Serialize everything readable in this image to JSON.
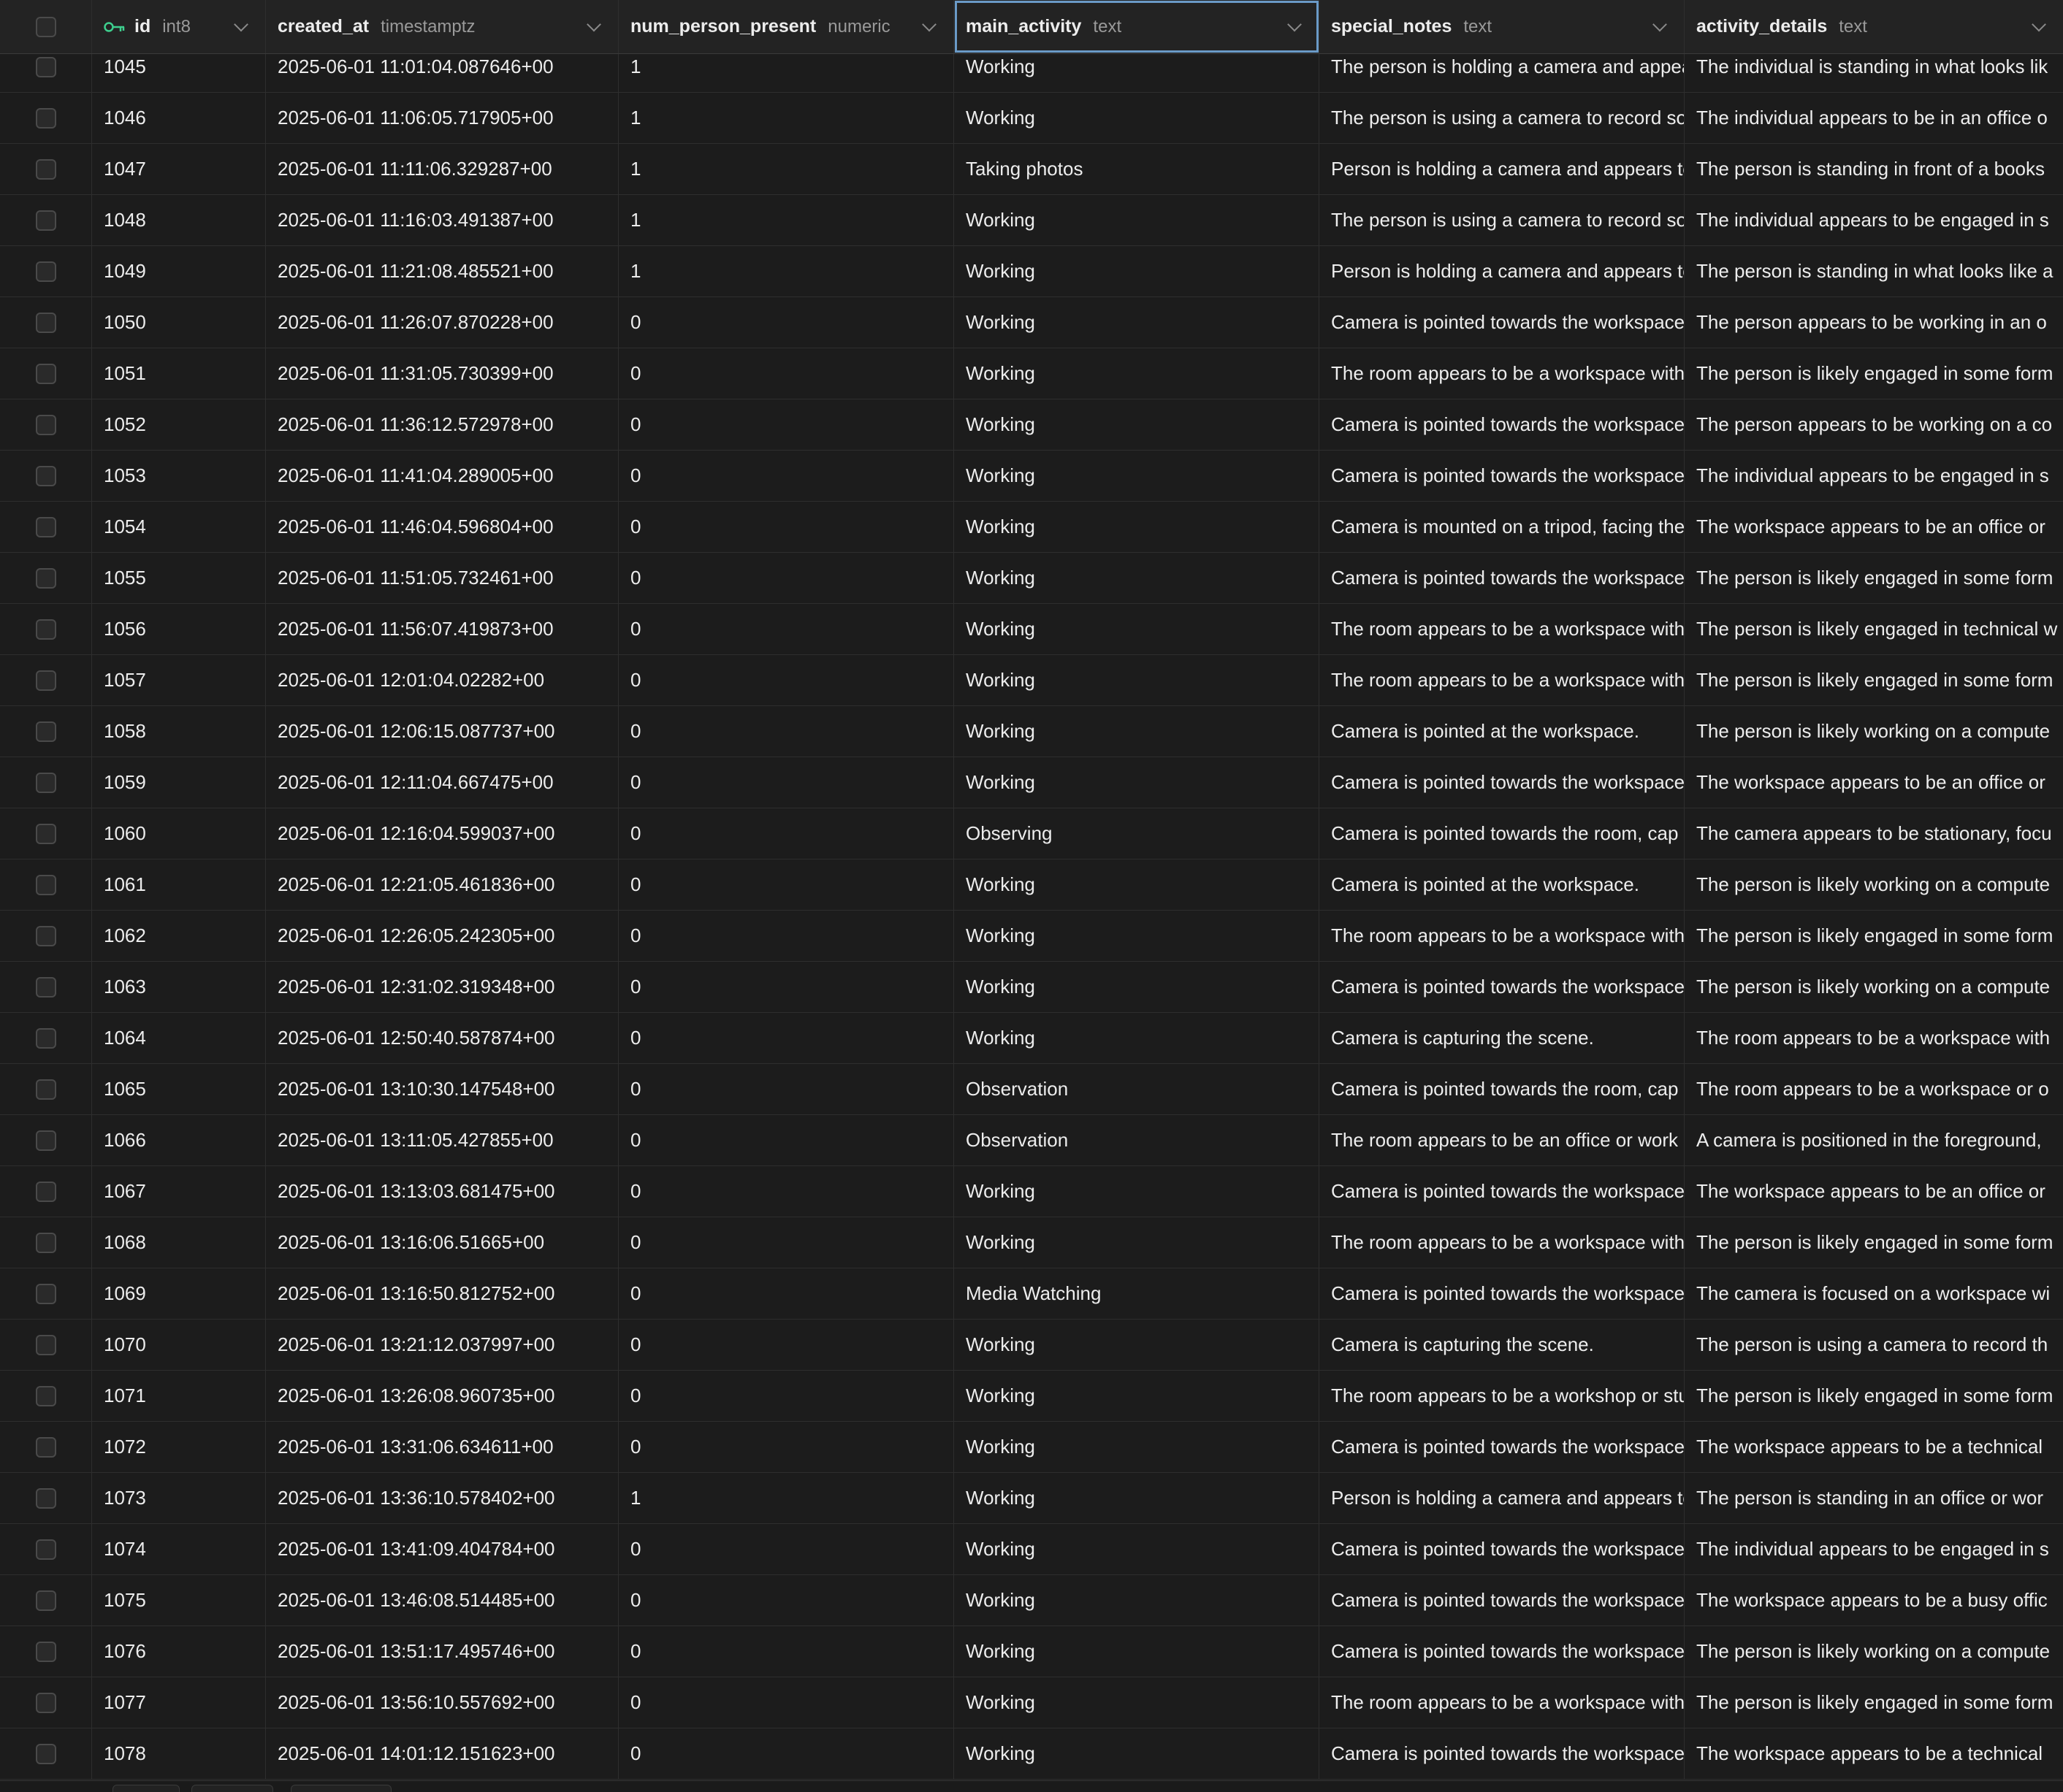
{
  "columns": [
    {
      "name": "id",
      "type": "int8",
      "primary_key": true
    },
    {
      "name": "created_at",
      "type": "timestamptz"
    },
    {
      "name": "num_person_present",
      "type": "numeric"
    },
    {
      "name": "main_activity",
      "type": "text",
      "selected": true
    },
    {
      "name": "special_notes",
      "type": "text"
    },
    {
      "name": "activity_details",
      "type": "text"
    }
  ],
  "rows": [
    [
      "1045",
      "2025-06-01 11:01:04.087646+00",
      "1",
      "Working",
      "The person is holding a camera and appea",
      "The individual is standing in what looks lik"
    ],
    [
      "1046",
      "2025-06-01 11:06:05.717905+00",
      "1",
      "Working",
      "The person is using a camera to record so",
      "The individual appears to be in an office o"
    ],
    [
      "1047",
      "2025-06-01 11:11:06.329287+00",
      "1",
      "Taking photos",
      "Person is holding a camera and appears to",
      "The person is standing in front of a books"
    ],
    [
      "1048",
      "2025-06-01 11:16:03.491387+00",
      "1",
      "Working",
      "The person is using a camera to record so",
      "The individual appears to be engaged in s"
    ],
    [
      "1049",
      "2025-06-01 11:21:08.485521+00",
      "1",
      "Working",
      "Person is holding a camera and appears to",
      "The person is standing in what looks like a"
    ],
    [
      "1050",
      "2025-06-01 11:26:07.870228+00",
      "0",
      "Working",
      "Camera is pointed towards the workspace",
      "The person appears to be working in an o"
    ],
    [
      "1051",
      "2025-06-01 11:31:05.730399+00",
      "0",
      "Working",
      "The room appears to be a workspace with",
      "The person is likely engaged in some form"
    ],
    [
      "1052",
      "2025-06-01 11:36:12.572978+00",
      "0",
      "Working",
      "Camera is pointed towards the workspace",
      "The person appears to be working on a co"
    ],
    [
      "1053",
      "2025-06-01 11:41:04.289005+00",
      "0",
      "Working",
      "Camera is pointed towards the workspace",
      "The individual appears to be engaged in s"
    ],
    [
      "1054",
      "2025-06-01 11:46:04.596804+00",
      "0",
      "Working",
      "Camera is mounted on a tripod, facing the",
      "The workspace appears to be an office or"
    ],
    [
      "1055",
      "2025-06-01 11:51:05.732461+00",
      "0",
      "Working",
      "Camera is pointed towards the workspace",
      "The person is likely engaged in some form"
    ],
    [
      "1056",
      "2025-06-01 11:56:07.419873+00",
      "0",
      "Working",
      "The room appears to be a workspace with",
      "The person is likely engaged in technical w"
    ],
    [
      "1057",
      "2025-06-01 12:01:04.02282+00",
      "0",
      "Working",
      "The room appears to be a workspace with",
      "The person is likely engaged in some form"
    ],
    [
      "1058",
      "2025-06-01 12:06:15.087737+00",
      "0",
      "Working",
      "Camera is pointed at the workspace.",
      "The person is likely working on a compute"
    ],
    [
      "1059",
      "2025-06-01 12:11:04.667475+00",
      "0",
      "Working",
      "Camera is pointed towards the workspace",
      "The workspace appears to be an office or"
    ],
    [
      "1060",
      "2025-06-01 12:16:04.599037+00",
      "0",
      "Observing",
      "Camera is pointed towards the room, cap",
      "The camera appears to be stationary, focu"
    ],
    [
      "1061",
      "2025-06-01 12:21:05.461836+00",
      "0",
      "Working",
      "Camera is pointed at the workspace.",
      "The person is likely working on a compute"
    ],
    [
      "1062",
      "2025-06-01 12:26:05.242305+00",
      "0",
      "Working",
      "The room appears to be a workspace with",
      "The person is likely engaged in some form"
    ],
    [
      "1063",
      "2025-06-01 12:31:02.319348+00",
      "0",
      "Working",
      "Camera is pointed towards the workspace",
      "The person is likely working on a compute"
    ],
    [
      "1064",
      "2025-06-01 12:50:40.587874+00",
      "0",
      "Working",
      "Camera is capturing the scene.",
      "The room appears to be a workspace with"
    ],
    [
      "1065",
      "2025-06-01 13:10:30.147548+00",
      "0",
      "Observation",
      "Camera is pointed towards the room, cap",
      "The room appears to be a workspace or o"
    ],
    [
      "1066",
      "2025-06-01 13:11:05.427855+00",
      "0",
      "Observation",
      "The room appears to be an office or work",
      "A camera is positioned in the foreground,"
    ],
    [
      "1067",
      "2025-06-01 13:13:03.681475+00",
      "0",
      "Working",
      "Camera is pointed towards the workspace",
      "The workspace appears to be an office or"
    ],
    [
      "1068",
      "2025-06-01 13:16:06.51665+00",
      "0",
      "Working",
      "The room appears to be a workspace with",
      "The person is likely engaged in some form"
    ],
    [
      "1069",
      "2025-06-01 13:16:50.812752+00",
      "0",
      "Media Watching",
      "Camera is pointed towards the workspace",
      "The camera is focused on a workspace wi"
    ],
    [
      "1070",
      "2025-06-01 13:21:12.037997+00",
      "0",
      "Working",
      "Camera is capturing the scene.",
      "The person is using a camera to record th"
    ],
    [
      "1071",
      "2025-06-01 13:26:08.960735+00",
      "0",
      "Working",
      "The room appears to be a workshop or stu",
      "The person is likely engaged in some form"
    ],
    [
      "1072",
      "2025-06-01 13:31:06.634611+00",
      "0",
      "Working",
      "Camera is pointed towards the workspace",
      "The workspace appears to be a technical"
    ],
    [
      "1073",
      "2025-06-01 13:36:10.578402+00",
      "1",
      "Working",
      "Person is holding a camera and appears to",
      "The person is standing in an office or wor"
    ],
    [
      "1074",
      "2025-06-01 13:41:09.404784+00",
      "0",
      "Working",
      "Camera is pointed towards the workspace",
      "The individual appears to be engaged in s"
    ],
    [
      "1075",
      "2025-06-01 13:46:08.514485+00",
      "0",
      "Working",
      "Camera is pointed towards the workspace",
      "The workspace appears to be a busy offic"
    ],
    [
      "1076",
      "2025-06-01 13:51:17.495746+00",
      "0",
      "Working",
      "Camera is pointed towards the workspace",
      "The person is likely working on a compute"
    ],
    [
      "1077",
      "2025-06-01 13:56:10.557692+00",
      "0",
      "Working",
      "The room appears to be a workspace with",
      "The person is likely engaged in some form"
    ],
    [
      "1078",
      "2025-06-01 14:01:12.151623+00",
      "0",
      "Working",
      "Camera is pointed towards the workspace",
      "The workspace appears to be a technical"
    ]
  ],
  "colors": {
    "background": "#1c1c1c",
    "header_background": "#232323",
    "selected_outline": "#6a9ac7",
    "key_icon": "#3ecf8e",
    "text": "#ededed",
    "muted_text": "#9a9a9a"
  },
  "icons": {
    "primary_key": "key-icon",
    "sort_menu": "chevron-down-icon",
    "row_select": "checkbox"
  }
}
